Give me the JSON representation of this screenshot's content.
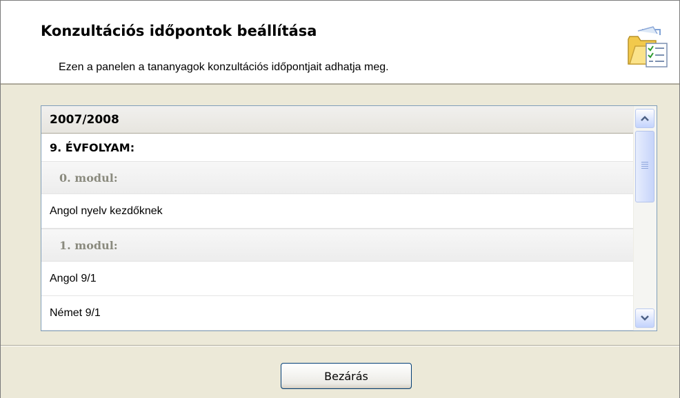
{
  "header": {
    "title": "Konzultációs időpontok beállítása",
    "subtitle": "Ezen a panelen a tananyagok konzultációs időpontjait adhatja meg.",
    "icon": "folder-checklist-icon"
  },
  "list": {
    "year": "2007/2008",
    "grade": "9. ÉVFOLYAM:",
    "rows": [
      {
        "type": "module",
        "label": "0. modul:"
      },
      {
        "type": "subject",
        "label": "Angol nyelv kezdőknek"
      },
      {
        "type": "module",
        "label": "1. modul:"
      },
      {
        "type": "subject",
        "label": "Angol 9/1"
      },
      {
        "type": "subject",
        "label": "Német 9/1"
      }
    ]
  },
  "scrollbar": {
    "up_icon": "scroll-up-arrow-icon",
    "down_icon": "scroll-down-arrow-icon",
    "position": 0.0
  },
  "footer": {
    "close_label": "Bezárás"
  },
  "colors": {
    "background": "#ECE9D8",
    "module_text": "#8A8A7E",
    "list_border": "#7F9DB9"
  }
}
